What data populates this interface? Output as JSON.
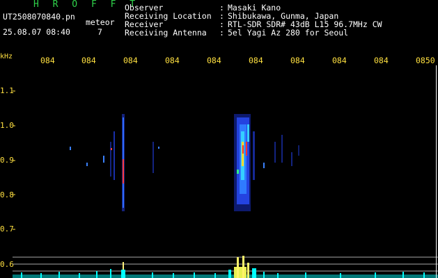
{
  "app_title": "H R O F F T",
  "file_name": "UT2508070840.pn",
  "meteor_label": "meteor",
  "date_time": "25.08.07 08:40",
  "count": "7",
  "info": [
    {
      "label": "Observer",
      "value": "Masaki Kano"
    },
    {
      "label": "Receiving Location",
      "value": "Shibukawa, Gunma, Japan"
    },
    {
      "label": "Receiver",
      "value": "RTL-SDR SDR# 43dB L15 96.7MHz CW"
    },
    {
      "label": "Receiving Antenna",
      "value": "5el Yagi Az 280 for Seoul"
    }
  ],
  "freq_unit": "kHz",
  "time_ticks": [
    "084",
    "084",
    "084",
    "084",
    "084",
    "084",
    "084",
    "084",
    "084",
    "0850"
  ],
  "freq_ticks": [
    "1.1",
    "1.0",
    "0.9",
    "0.8",
    "0.7",
    "0.6"
  ],
  "colors": {
    "background": "#000000",
    "title": "#2fd24a",
    "axis_labels": "#ffe040",
    "spectrum": "#00ffff"
  }
}
